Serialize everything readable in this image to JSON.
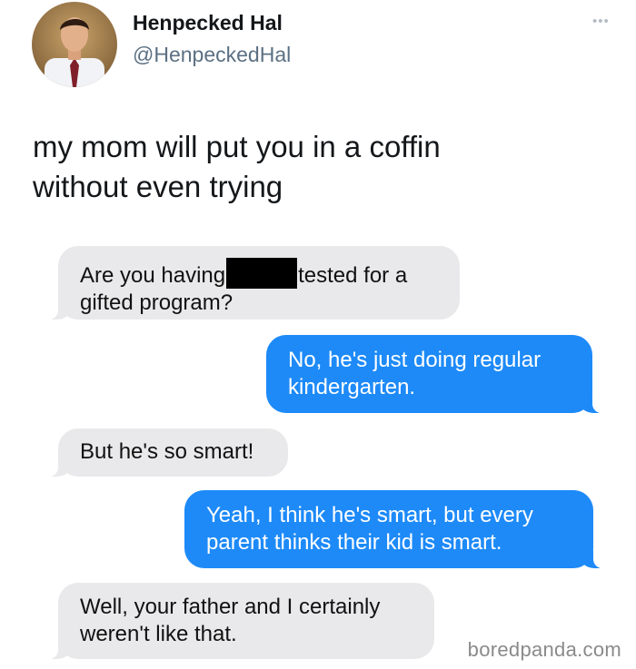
{
  "tweet": {
    "author": {
      "display_name": "Henpecked Hal",
      "handle": "@HenpeckedHal"
    },
    "more_icon": "more-horizontal-icon",
    "text_line1": "my mom will put you in a coffin",
    "text_line2": "without even trying"
  },
  "messages": {
    "m1": {
      "sender": "incoming",
      "part1": "Are you having",
      "part2": "tested for a",
      "line2": "gifted program?"
    },
    "m2": {
      "sender": "outgoing",
      "line1": "No, he's just doing regular",
      "line2": "kindergarten."
    },
    "m3": {
      "sender": "incoming",
      "line1": "But he's so smart!"
    },
    "m4": {
      "sender": "outgoing",
      "line1": "Yeah, I think he's smart, but every",
      "line2": "parent thinks their kid is smart."
    },
    "m5": {
      "sender": "incoming",
      "line1": "Well, your father and I certainly",
      "line2": "weren't like that."
    }
  },
  "watermark": "boredpanda.com",
  "colors": {
    "incoming_bubble": "#e9e9eb",
    "outgoing_bubble": "#1d8af8",
    "handle_gray": "#5b7083",
    "redaction": "#000000"
  }
}
